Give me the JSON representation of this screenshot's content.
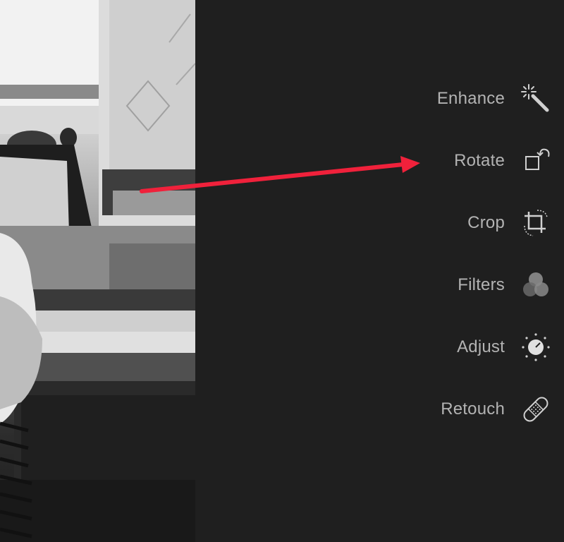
{
  "menu": {
    "items": [
      {
        "label": "Enhance",
        "icon": "magic-wand-icon"
      },
      {
        "label": "Rotate",
        "icon": "rotate-icon"
      },
      {
        "label": "Crop",
        "icon": "crop-icon"
      },
      {
        "label": "Filters",
        "icon": "filters-icon"
      },
      {
        "label": "Adjust",
        "icon": "adjust-icon"
      },
      {
        "label": "Retouch",
        "icon": "bandage-icon"
      }
    ]
  },
  "colors": {
    "panel_background": "#1f1f1f",
    "label_color": "#b3b3b3",
    "icon_color": "#d0d0d0",
    "annotation_arrow": "#f0213b"
  }
}
